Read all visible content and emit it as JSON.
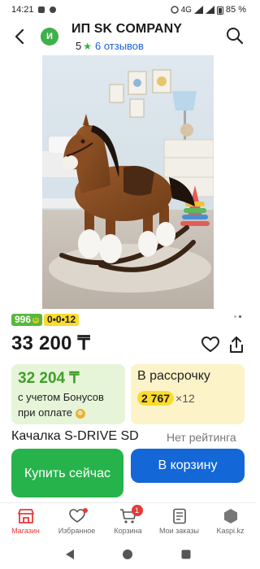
{
  "status_bar": {
    "time": "14:21",
    "network": "4G",
    "battery": "85 %"
  },
  "header": {
    "seller_initial": "И",
    "seller_name": "ИП SK COMPANY",
    "rating": "5",
    "reviews_label": "6 отзывов"
  },
  "product": {
    "bonus_badge": "996",
    "installment_badge": "0•0•12",
    "price": "33 200 ₸",
    "title": "Качалка S-DRIVE SD",
    "rating_status": "Нет рейтинга"
  },
  "bonus_card": {
    "price": "32 204 ₸",
    "caption": "с учетом Бонусов при оплате"
  },
  "installment_card": {
    "title": "В рассрочку",
    "amount": "2 767",
    "times": "×12"
  },
  "actions": {
    "buy_now": "Купить сейчас",
    "add_to_cart": "В корзину"
  },
  "bottom_nav": {
    "items": [
      {
        "label": "Магазин",
        "icon": "shop-icon",
        "active": true
      },
      {
        "label": "Избранное",
        "icon": "heart-icon",
        "active": false
      },
      {
        "label": "Корзина",
        "icon": "cart-icon",
        "active": false,
        "badge": "1"
      },
      {
        "label": "Мои заказы",
        "icon": "orders-icon",
        "active": false
      },
      {
        "label": "Kaspi.kz",
        "icon": "kaspi-icon",
        "active": false
      }
    ]
  },
  "colors": {
    "accent_green": "#27b34c",
    "accent_blue": "#1367d6",
    "accent_red": "#e53a3a",
    "installment_yellow": "#fbdc2d"
  }
}
